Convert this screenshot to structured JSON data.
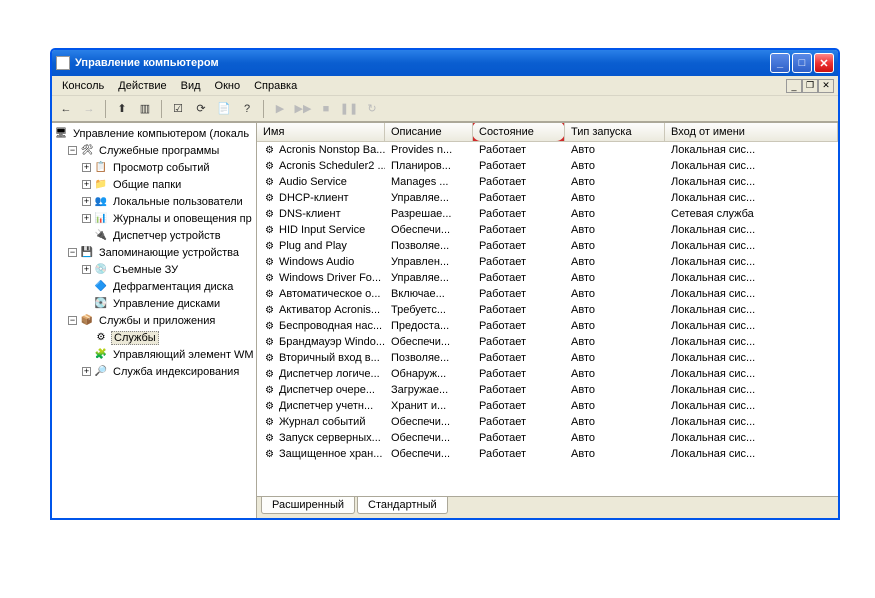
{
  "window": {
    "title": "Управление компьютером"
  },
  "menu": {
    "items": [
      "Консоль",
      "Действие",
      "Вид",
      "Окно",
      "Справка"
    ]
  },
  "tree": {
    "root": "Управление компьютером (локаль",
    "n1": "Служебные программы",
    "n1a": "Просмотр событий",
    "n1b": "Общие папки",
    "n1c": "Локальные пользователи",
    "n1d": "Журналы и оповещения пр",
    "n1e": "Диспетчер устройств",
    "n2": "Запоминающие устройства",
    "n2a": "Съемные ЗУ",
    "n2b": "Дефрагментация диска",
    "n2c": "Управление дисками",
    "n3": "Службы и приложения",
    "n3a": "Службы",
    "n3b": "Управляющий элемент WM",
    "n3c": "Служба индексирования"
  },
  "columns": {
    "name": "Имя",
    "desc": "Описание",
    "state": "Состояние",
    "start": "Тип запуска",
    "logon": "Вход от имени"
  },
  "services": [
    {
      "name": "Acronis Nonstop Ba...",
      "desc": "Provides n...",
      "state": "Работает",
      "start": "Авто",
      "logon": "Локальная сис..."
    },
    {
      "name": "Acronis Scheduler2 ...",
      "desc": "Планиров...",
      "state": "Работает",
      "start": "Авто",
      "logon": "Локальная сис..."
    },
    {
      "name": "Audio Service",
      "desc": "Manages ...",
      "state": "Работает",
      "start": "Авто",
      "logon": "Локальная сис..."
    },
    {
      "name": "DHCP-клиент",
      "desc": "Управляе...",
      "state": "Работает",
      "start": "Авто",
      "logon": "Локальная сис..."
    },
    {
      "name": "DNS-клиент",
      "desc": "Разрешае...",
      "state": "Работает",
      "start": "Авто",
      "logon": "Сетевая служба"
    },
    {
      "name": "HID Input Service",
      "desc": "Обеспечи...",
      "state": "Работает",
      "start": "Авто",
      "logon": "Локальная сис..."
    },
    {
      "name": "Plug and Play",
      "desc": "Позволяе...",
      "state": "Работает",
      "start": "Авто",
      "logon": "Локальная сис..."
    },
    {
      "name": "Windows Audio",
      "desc": "Управлен...",
      "state": "Работает",
      "start": "Авто",
      "logon": "Локальная сис..."
    },
    {
      "name": "Windows Driver Fo...",
      "desc": "Управляе...",
      "state": "Работает",
      "start": "Авто",
      "logon": "Локальная сис..."
    },
    {
      "name": "Автоматическое о...",
      "desc": "Включае...",
      "state": "Работает",
      "start": "Авто",
      "logon": "Локальная сис..."
    },
    {
      "name": "Активатор Acronis...",
      "desc": "Требуетс...",
      "state": "Работает",
      "start": "Авто",
      "logon": "Локальная сис..."
    },
    {
      "name": "Беспроводная нас...",
      "desc": "Предоста...",
      "state": "Работает",
      "start": "Авто",
      "logon": "Локальная сис..."
    },
    {
      "name": "Брандмауэр Windo...",
      "desc": "Обеспечи...",
      "state": "Работает",
      "start": "Авто",
      "logon": "Локальная сис..."
    },
    {
      "name": "Вторичный вход в...",
      "desc": "Позволяе...",
      "state": "Работает",
      "start": "Авто",
      "logon": "Локальная сис..."
    },
    {
      "name": "Диспетчер логиче...",
      "desc": "Обнаруж...",
      "state": "Работает",
      "start": "Авто",
      "logon": "Локальная сис..."
    },
    {
      "name": "Диспетчер очере...",
      "desc": "Загружае...",
      "state": "Работает",
      "start": "Авто",
      "logon": "Локальная сис..."
    },
    {
      "name": "Диспетчер учетн...",
      "desc": "Хранит и...",
      "state": "Работает",
      "start": "Авто",
      "logon": "Локальная сис..."
    },
    {
      "name": "Журнал событий",
      "desc": "Обеспечи...",
      "state": "Работает",
      "start": "Авто",
      "logon": "Локальная сис..."
    },
    {
      "name": "Запуск серверных...",
      "desc": "Обеспечи...",
      "state": "Работает",
      "start": "Авто",
      "logon": "Локальная сис..."
    },
    {
      "name": "Защищенное хран...",
      "desc": "Обеспечи...",
      "state": "Работает",
      "start": "Авто",
      "logon": "Локальная сис..."
    }
  ],
  "tabs": {
    "extended": "Расширенный",
    "standard": "Стандартный"
  }
}
